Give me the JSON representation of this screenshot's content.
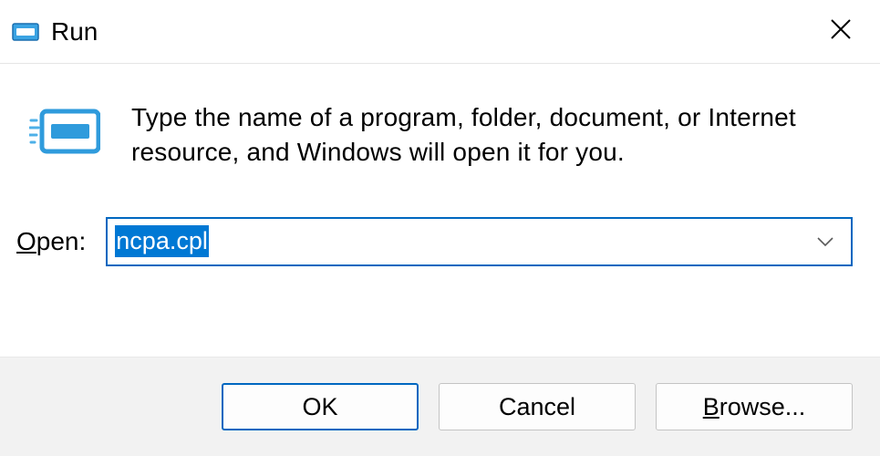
{
  "titlebar": {
    "title": "Run",
    "close_icon": "close"
  },
  "content": {
    "description": "Type the name of a program, folder, document, or Internet resource, and Windows will open it for you."
  },
  "open": {
    "label_prefix": "O",
    "label_rest": "pen:",
    "value": "ncpa.cpl"
  },
  "buttons": {
    "ok": "OK",
    "cancel": "Cancel",
    "browse_prefix": "B",
    "browse_rest": "rowse..."
  }
}
